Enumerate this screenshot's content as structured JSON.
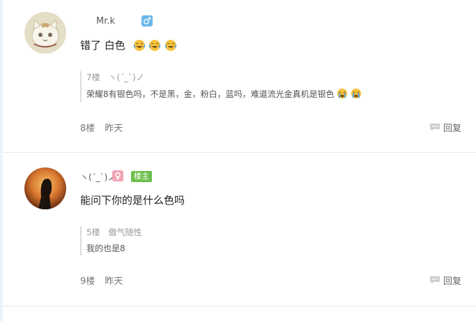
{
  "posts": [
    {
      "username": "Mr.k",
      "gender": "male",
      "content": "错了 白色",
      "emoji_count": 3,
      "quote": {
        "floor": "7楼",
        "author": "ヽ(ˊ_ˋ)ノ",
        "text": "荣耀8有银色吗，不是黑，金，粉白，蓝吗，难道流光金真机是银色"
      },
      "floor": "8楼",
      "time": "昨天",
      "reply_label": "回复"
    },
    {
      "username": "ヽ(ˊ_ˋ)ノ",
      "gender": "female",
      "badge": "楼主",
      "content": "能问下你的是什么色吗",
      "quote": {
        "floor": "5楼",
        "author": "傲气随性",
        "text": "我的也是8"
      },
      "floor": "9楼",
      "time": "昨天",
      "reply_label": "回复"
    }
  ]
}
